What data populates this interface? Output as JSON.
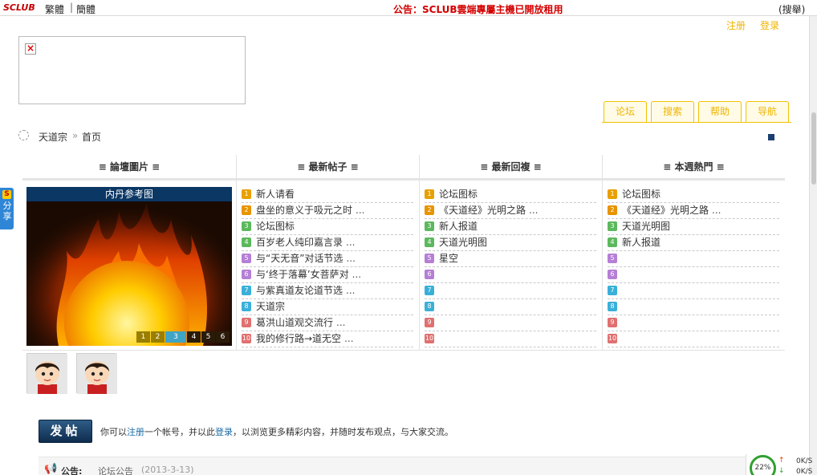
{
  "topbar": {
    "logo": "SCLUB",
    "traditional": "繁體",
    "separator": "|",
    "simplified": "簡體",
    "notice": "公告：SCLUB雲端專屬主機已開放租用",
    "search": "(搜舉)"
  },
  "auth": {
    "register": "注册",
    "login": "登录"
  },
  "nav_tabs": [
    "论坛",
    "搜索",
    "帮助",
    "导航"
  ],
  "breadcrumb": {
    "home": "天道宗",
    "separator": "»",
    "current": "首页"
  },
  "share": {
    "logo": "S",
    "label": "分享"
  },
  "columns": {
    "photos": "≡ 論壇圖片 ≡",
    "latest_posts": "≡ 最新帖子 ≡",
    "latest_replies": "≡ 最新回複 ≡",
    "hot_week": "≡ 本週熱門 ≡"
  },
  "photo": {
    "caption": "内丹参考图",
    "pages": [
      "1",
      "2",
      "3",
      "4",
      "5",
      "6"
    ],
    "active_page": "3"
  },
  "latest_posts": [
    {
      "n": "1",
      "title": "新人请看",
      "more": ""
    },
    {
      "n": "2",
      "title": "盘坐的意义于吸元之时",
      "more": "..."
    },
    {
      "n": "3",
      "title": "论坛图标",
      "more": ""
    },
    {
      "n": "4",
      "title": "百岁老人纯印嘉言录",
      "more": "..."
    },
    {
      "n": "5",
      "title": "与“天无音”对话节选",
      "more": "..."
    },
    {
      "n": "6",
      "title": "与‘终于落幕’女菩萨对",
      "more": "..."
    },
    {
      "n": "7",
      "title": "与紫真道友论道节选",
      "more": "..."
    },
    {
      "n": "8",
      "title": "天道宗",
      "more": ""
    },
    {
      "n": "9",
      "title": "葛洪山道观交流行",
      "more": "..."
    },
    {
      "n": "10",
      "title": "我的修行路→道无空",
      "more": "..."
    }
  ],
  "latest_replies": [
    {
      "n": "1",
      "title": "论坛图标",
      "more": ""
    },
    {
      "n": "2",
      "title": "《天道经》光明之路",
      "more": "..."
    },
    {
      "n": "3",
      "title": "新人报道",
      "more": ""
    },
    {
      "n": "4",
      "title": "天道光明图",
      "more": ""
    },
    {
      "n": "5",
      "title": "星空",
      "more": ""
    },
    {
      "n": "6",
      "title": "",
      "more": ""
    },
    {
      "n": "7",
      "title": "",
      "more": ""
    },
    {
      "n": "8",
      "title": "",
      "more": ""
    },
    {
      "n": "9",
      "title": "",
      "more": ""
    },
    {
      "n": "10",
      "title": "",
      "more": ""
    }
  ],
  "hot_week": [
    {
      "n": "1",
      "title": "论坛图标",
      "more": ""
    },
    {
      "n": "2",
      "title": "《天道经》光明之路",
      "more": "..."
    },
    {
      "n": "3",
      "title": "天道光明图",
      "more": ""
    },
    {
      "n": "4",
      "title": "新人报道",
      "more": ""
    },
    {
      "n": "5",
      "title": "",
      "more": ""
    },
    {
      "n": "6",
      "title": "",
      "more": ""
    },
    {
      "n": "7",
      "title": "",
      "more": ""
    },
    {
      "n": "8",
      "title": "",
      "more": ""
    },
    {
      "n": "9",
      "title": "",
      "more": ""
    },
    {
      "n": "10",
      "title": "",
      "more": ""
    }
  ],
  "num_colors": [
    "#e8a000",
    "#e89400",
    "#5cb85c",
    "#5cb85c",
    "#b67fd6",
    "#b67fd6",
    "#3ab0d8",
    "#3ab0d8",
    "#e07070",
    "#e07070"
  ],
  "post": {
    "button": "发帖",
    "invite_prefix": "你可以",
    "invite_register": "注册",
    "invite_mid": "一个帐号，并以此",
    "invite_login": "登录",
    "invite_suffix": "，以浏览更多精彩内容，并随时发布观点，与大家交流。"
  },
  "footer": {
    "label": "公告:",
    "text": "论坛公告",
    "date": "(2013-3-13)"
  },
  "netmeter": {
    "percent": "22%",
    "up": "0K/S",
    "down": "0K/S"
  }
}
